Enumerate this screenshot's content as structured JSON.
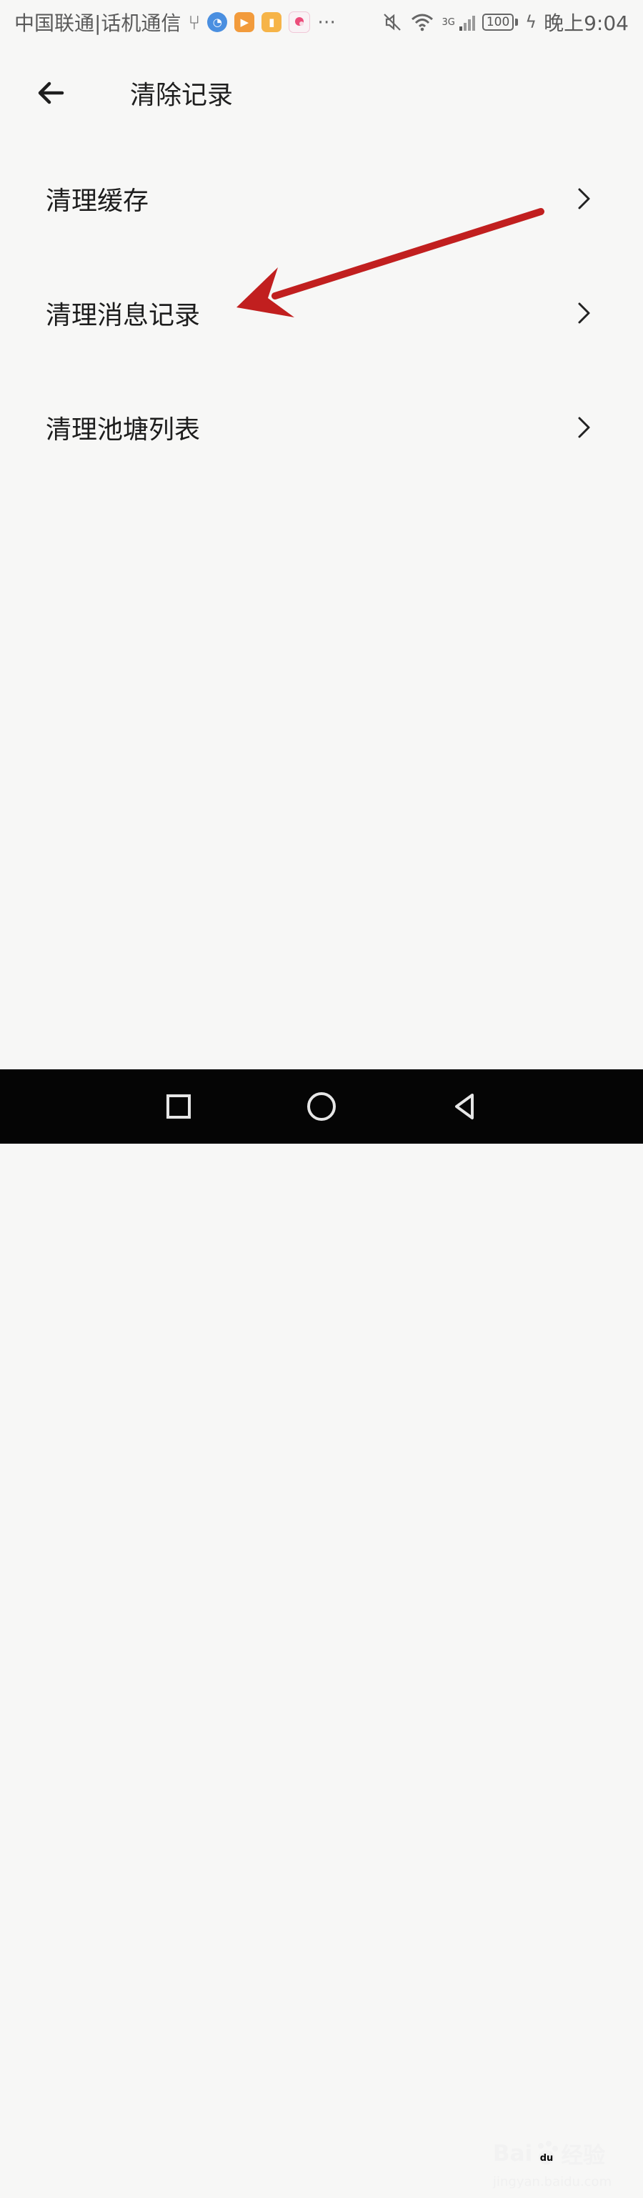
{
  "status_bar": {
    "carrier": "中国联通|话机通信",
    "network": "3G",
    "battery": "100",
    "time": "晚上9:04"
  },
  "header": {
    "title": "清除记录"
  },
  "menu": {
    "items": [
      {
        "label": "清理缓存"
      },
      {
        "label": "清理消息记录"
      },
      {
        "label": "清理池塘列表"
      }
    ]
  },
  "annotation": {
    "arrow_color": "#c11f1f"
  },
  "watermark": {
    "brand_left": "Bai",
    "brand_right": "经验",
    "site": "jingyan.baidu.com"
  },
  "colors": {
    "background": "#f7f7f6",
    "text": "#1f1f1f",
    "nav_bar": "#050505"
  }
}
